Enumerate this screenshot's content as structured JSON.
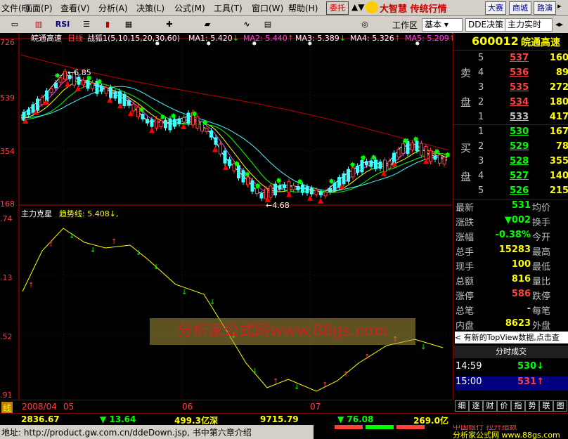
{
  "menubar": {
    "items": [
      "文件(F)",
      "画面(P)",
      "查看(V)",
      "分析(A)",
      "决策(L)",
      "公式(M)",
      "工具(T)",
      "窗口(W)",
      "帮助(H)"
    ],
    "entrust": "委托",
    "brand": "大智慧 传统行情",
    "buttons": [
      "大赛",
      "商城",
      "路演"
    ]
  },
  "toolbar": {
    "rsi": "RSI",
    "workspace_label": "工作区",
    "workspace_value": "基本",
    "dde_button": "DDE决策",
    "main_button": "主力实时"
  },
  "chart": {
    "header": {
      "name": "皖通高速",
      "period": "日线",
      "indicator": "战狐1(5,10,15,20,30,60)",
      "ma": [
        {
          "label": "MA1: 5.420",
          "arrow": "↓",
          "color": "#ffffff"
        },
        {
          "label": "MA2: 5.440",
          "arrow": "↑",
          "color": "#ff40ff"
        },
        {
          "label": "MA3: 5.389",
          "arrow": "↓",
          "color": "#ffffff"
        },
        {
          "label": "MA4: 5.326",
          "arrow": "↑",
          "color": "#ffffff"
        },
        {
          "label": "MA5: 5.209",
          "arrow": "↑",
          "color": "#ff40ff"
        }
      ]
    },
    "y_labels_top": [
      "726",
      "539",
      "354",
      "168"
    ],
    "annotations": {
      "high": "6.85",
      "low": "4.68"
    },
    "sub": {
      "title": "主力克星",
      "trend": "趋势线: 5.408",
      "trend_arrow": "↓",
      "y_labels": [
        ".74",
        ".13",
        ".52",
        ".91"
      ]
    },
    "watermark": "分析家公式网www.88gs.com",
    "x_labels": [
      "线",
      "2008/04",
      "05",
      "06",
      "07"
    ]
  },
  "chart_data": {
    "type": "line",
    "x": [
      "2008/04",
      "05",
      "06",
      "07"
    ],
    "series": [
      {
        "name": "MA1",
        "values": [
          5.42
        ]
      },
      {
        "name": "MA2",
        "values": [
          5.44
        ]
      },
      {
        "name": "MA3",
        "values": [
          5.389
        ]
      },
      {
        "name": "MA4",
        "values": [
          5.326
        ]
      },
      {
        "name": "MA5",
        "values": [
          5.209
        ]
      },
      {
        "name": "趋势线",
        "values": [
          5.408
        ]
      }
    ]
  },
  "quote": {
    "code": "600012",
    "name": "皖通高速",
    "sell_label": [
      "卖",
      "盘"
    ],
    "buy_label": [
      "买",
      "盘"
    ],
    "sell": [
      {
        "level": "5",
        "price": "537",
        "vol": "160"
      },
      {
        "level": "4",
        "price": "536",
        "vol": "89"
      },
      {
        "level": "3",
        "price": "535",
        "vol": "272"
      },
      {
        "level": "2",
        "price": "534",
        "vol": "180"
      },
      {
        "level": "1",
        "price": "533",
        "vol": "417"
      }
    ],
    "buy": [
      {
        "level": "1",
        "price": "530",
        "vol": "167"
      },
      {
        "level": "2",
        "price": "529",
        "vol": "78"
      },
      {
        "level": "3",
        "price": "528",
        "vol": "355"
      },
      {
        "level": "4",
        "price": "527",
        "vol": "140"
      },
      {
        "level": "5",
        "price": "526",
        "vol": "215"
      }
    ],
    "info": [
      {
        "k": "最新",
        "v": "531",
        "c": "#00ff00",
        "k2": "均价"
      },
      {
        "k": "涨跌",
        "v": "▼002",
        "c": "#00ff00",
        "k2": "换手"
      },
      {
        "k": "涨幅",
        "v": "-0.38%",
        "c": "#00ff00",
        "k2": "今开"
      },
      {
        "k": "总手",
        "v": "15283",
        "c": "#ffff00",
        "k2": "最高"
      },
      {
        "k": "现手",
        "v": "100",
        "c": "#ffff00",
        "k2": "最低"
      },
      {
        "k": "总额",
        "v": "816",
        "c": "#ffff00",
        "k2": "量比"
      },
      {
        "k": "涨停",
        "v": "586",
        "c": "#ff4040",
        "k2": "跌停"
      },
      {
        "k": "总笔",
        "v": "-",
        "c": "#c0c0c0",
        "k2": "每笔"
      },
      {
        "k": "内盘",
        "v": "8623",
        "c": "#ffff00",
        "k2": "外盘"
      }
    ],
    "topview": "有新的TopView数据,点击查",
    "trade_header": "分时成交",
    "trades": [
      {
        "time": "14:59",
        "price": "530",
        "arrow": "↓",
        "c": "#00ff00"
      },
      {
        "time": "15:00",
        "price": "531",
        "arrow": "↑",
        "c": "#ff4040"
      }
    ],
    "tabs": [
      "细",
      "逐",
      "财",
      "价",
      "指",
      "势",
      "联",
      "图"
    ]
  },
  "indexbar": [
    {
      "t": "2836.67",
      "c": "#ffff00"
    },
    {
      "t": "▼ 13.64",
      "c": "#00ff00"
    },
    {
      "t": "499.3亿深",
      "c": "#ffff00"
    },
    {
      "t": "9715.79",
      "c": "#ffff00"
    },
    {
      "t": "▼ 76.08",
      "c": "#00ff00"
    },
    {
      "t": "269.0亿",
      "c": "#ffff00"
    }
  ],
  "status": {
    "text": "地址: http://product.gw.com.cn/ddeDown.jsp, 书中第六章介绍",
    "ticker": "分析家公式网 www.88gs.com",
    "ticker2": "中国银行 拉升指数"
  }
}
